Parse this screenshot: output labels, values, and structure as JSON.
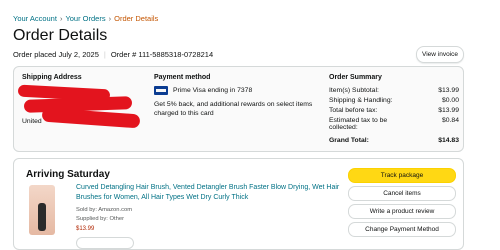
{
  "breadcrumb": {
    "items": [
      "Your Account",
      "Your Orders"
    ],
    "current": "Order Details",
    "separator": "›"
  },
  "page": {
    "title": "Order Details",
    "order_placed": "Order placed July 2, 2025",
    "order_number": "Order # 111-5885318-0728214",
    "view_invoice": "View invoice"
  },
  "shipping": {
    "heading": "Shipping Address",
    "visible_fragment": "United"
  },
  "payment": {
    "heading": "Payment method",
    "card": "Prime Visa ending in 7378",
    "reward": "Get 5% back, and additional rewards on select items charged to this card",
    "card_icon": "visa-card-icon"
  },
  "summary": {
    "heading": "Order Summary",
    "rows": [
      {
        "label": "Item(s) Subtotal:",
        "value": "$13.99"
      },
      {
        "label": "Shipping & Handling:",
        "value": "$0.00"
      },
      {
        "label": "Total before tax:",
        "value": "$13.99"
      },
      {
        "label": "Estimated tax to be collected:",
        "value": "$0.84"
      },
      {
        "label": "Grand Total:",
        "value": "$14.83"
      }
    ]
  },
  "shipment": {
    "status": "Arriving Saturday",
    "product_title": "Curved Detangling Hair Brush, Vented Detangler Brush Faster Blow Drying, Wet Hair Brushes for Women, All Hair Types Wet Dry Curly Thick",
    "sold_by": "Sold by: Amazon.com",
    "supplied_by": "Supplied by: Other",
    "price": "$13.99",
    "buttons": {
      "track": "Track package",
      "cancel": "Cancel items",
      "review": "Write a product review",
      "change_payment": "Change Payment Method"
    }
  },
  "colors": {
    "link": "#007185",
    "current_crumb": "#c45500",
    "primary_button": "#ffd814",
    "redaction": "#e3141e",
    "price": "#b12704"
  }
}
